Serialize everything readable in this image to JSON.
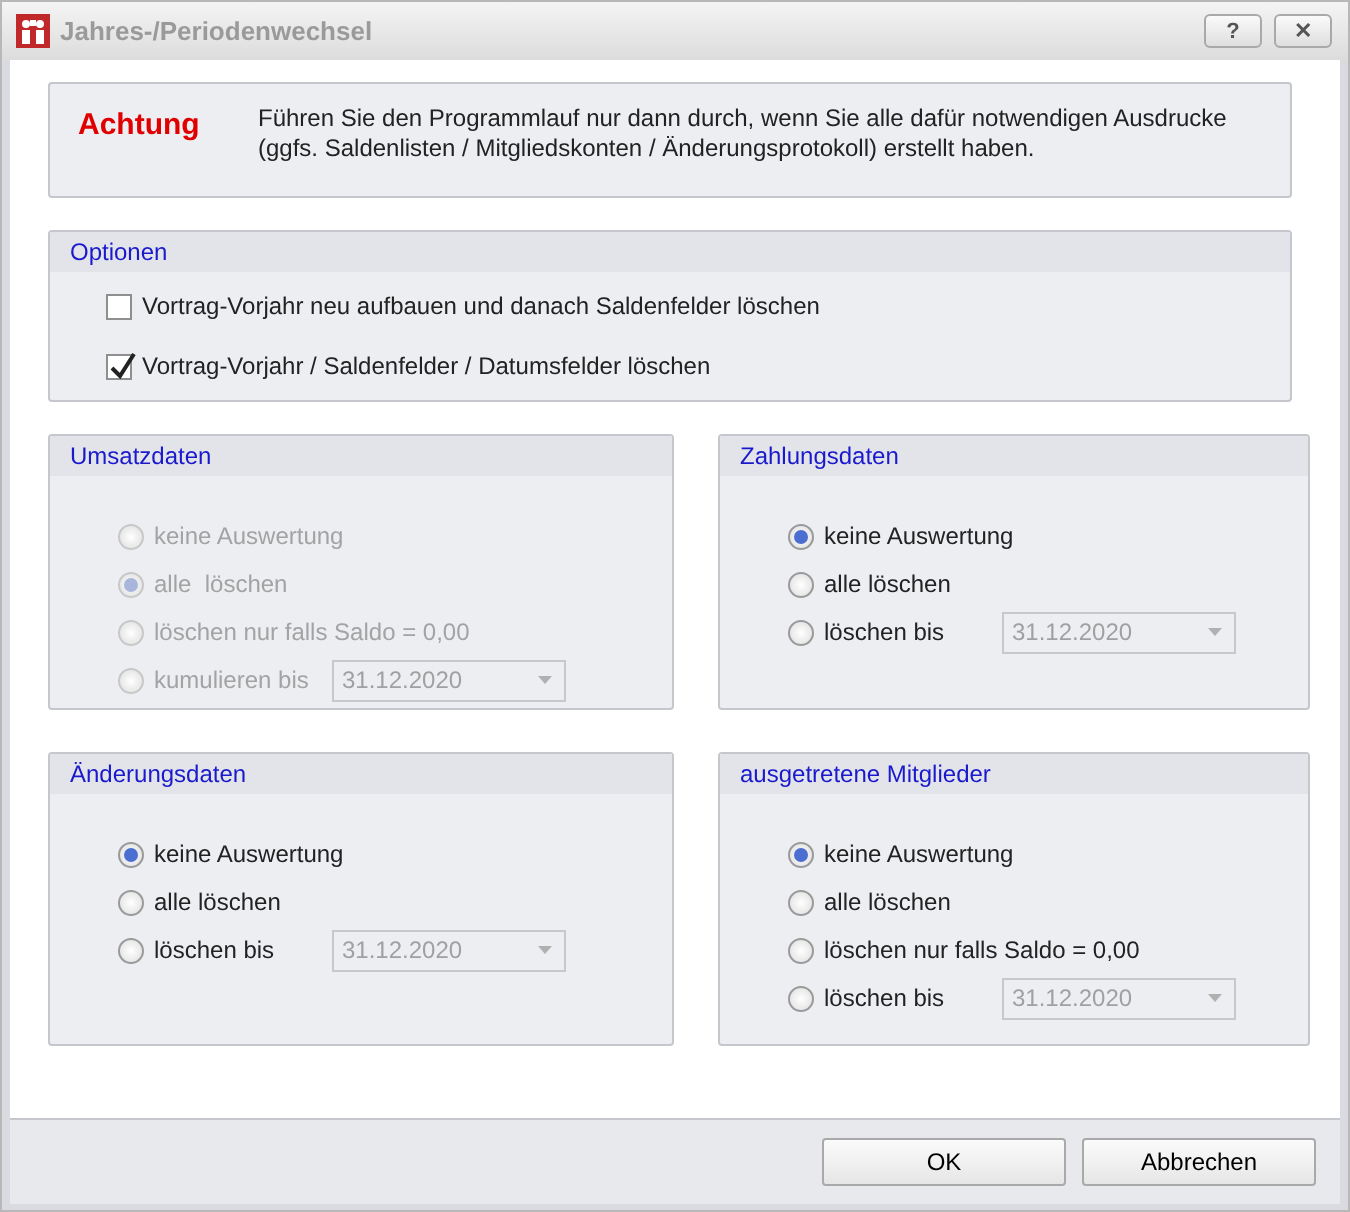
{
  "window": {
    "title": "Jahres-/Periodenwechsel",
    "buttons": [
      "?",
      "✕"
    ]
  },
  "warning": {
    "heading": "Achtung",
    "text": "Führen Sie den Programmlauf nur dann durch, wenn Sie alle dafür notwendigen Ausdrucke (ggfs. Saldenlisten / Mitgliedskonten / Änderungsprotokoll) erstellt haben."
  },
  "options": {
    "title": "Optionen",
    "items": [
      {
        "label": "Vortrag-Vorjahr neu aufbauen und danach Saldenfelder löschen",
        "checked": false
      },
      {
        "label": "Vortrag-Vorjahr / Saldenfelder / Datumsfelder löschen",
        "checked": true
      }
    ]
  },
  "groups": [
    {
      "title": "Umsatzdaten",
      "disabled": true,
      "options": [
        {
          "label": "keine Auswertung",
          "selected": false
        },
        {
          "label": "alle  löschen",
          "selected": true
        },
        {
          "label": "löschen nur falls Saldo = 0,00",
          "selected": false
        },
        {
          "label": "kumulieren bis",
          "selected": false,
          "date": "31.12.2020"
        }
      ]
    },
    {
      "title": "Zahlungsdaten",
      "disabled": false,
      "options": [
        {
          "label": "keine Auswertung",
          "selected": true
        },
        {
          "label": "alle löschen",
          "selected": false
        },
        {
          "label": "löschen bis",
          "selected": false,
          "date": "31.12.2020"
        }
      ]
    },
    {
      "title": "Änderungsdaten",
      "disabled": false,
      "options": [
        {
          "label": "keine Auswertung",
          "selected": true
        },
        {
          "label": "alle löschen",
          "selected": false
        },
        {
          "label": "löschen bis",
          "selected": false,
          "date": "31.12.2020"
        }
      ]
    },
    {
      "title": "ausgetretene Mitglieder",
      "disabled": false,
      "options": [
        {
          "label": "keine Auswertung",
          "selected": true
        },
        {
          "label": "alle löschen",
          "selected": false
        },
        {
          "label": "löschen nur falls Saldo = 0,00",
          "selected": false
        },
        {
          "label": "löschen bis",
          "selected": false,
          "date": "31.12.2020"
        }
      ]
    }
  ],
  "footer": {
    "buttons": [
      "OK",
      "Abbrechen"
    ]
  }
}
